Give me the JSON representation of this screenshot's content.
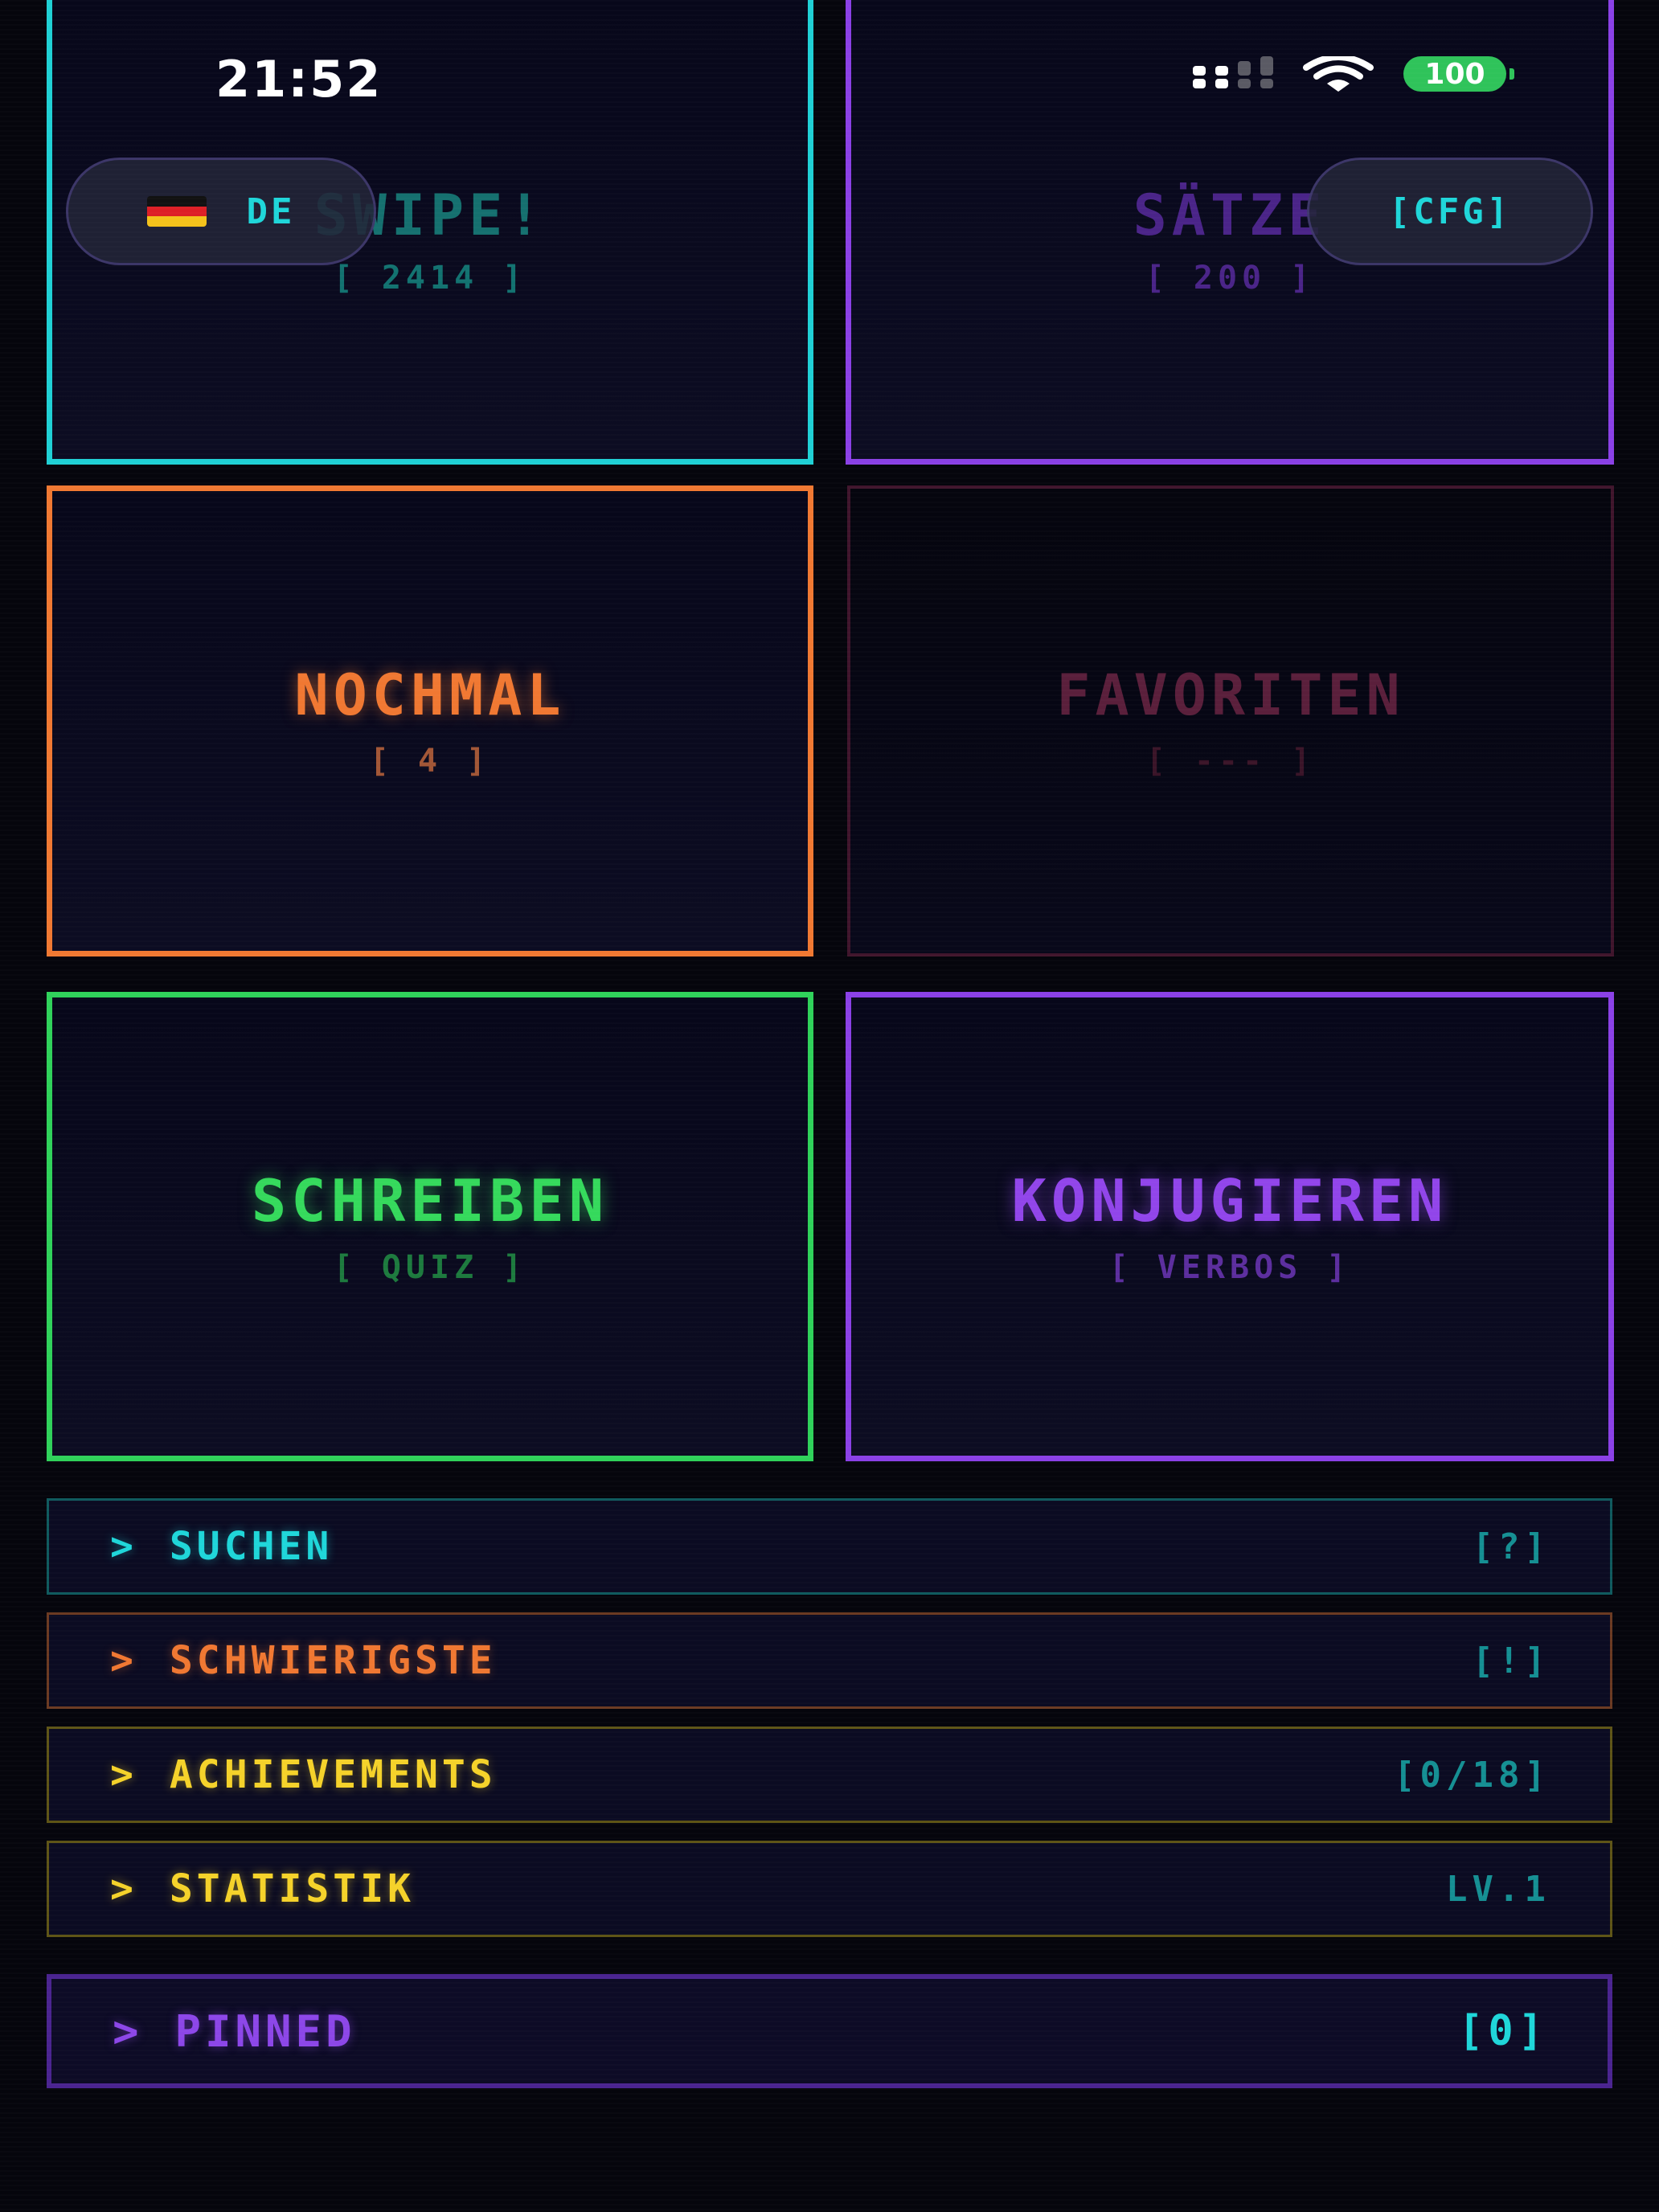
{
  "status_bar": {
    "time": "21:52",
    "battery": "100",
    "icons": [
      "signal-icon",
      "wifi-icon",
      "battery-icon"
    ]
  },
  "header": {
    "language_flag": "flag-de-icon",
    "language_label": "DE",
    "config_label": "[CFG]"
  },
  "tiles": {
    "swipe": {
      "title": "SWIPE!",
      "subtitle": "[ 2414 ]"
    },
    "saetze": {
      "title": "SÄTZE",
      "subtitle": "[ 200 ]"
    },
    "nochmal": {
      "title": "NOCHMAL",
      "subtitle": "[ 4 ]"
    },
    "favoriten": {
      "title": "FAVORITEN",
      "subtitle": "[ --- ]"
    },
    "schreiben": {
      "title": "SCHREIBEN",
      "subtitle": "[ QUIZ ]"
    },
    "konjugieren": {
      "title": "KONJUGIEREN",
      "subtitle": "[ VERBOS ]"
    }
  },
  "menu": {
    "prompt": ">",
    "items": [
      {
        "label": "SUCHEN",
        "badge": "[?]"
      },
      {
        "label": "SCHWIERIGSTE",
        "badge": "[!]"
      },
      {
        "label": "ACHIEVEMENTS",
        "badge": "[0/18]"
      },
      {
        "label": "STATISTIK",
        "badge": "LV.1"
      }
    ],
    "pinned": {
      "label": "PINNED",
      "badge": "[0]"
    }
  },
  "colors": {
    "cyan": "#1fd0d5",
    "purple": "#8a40e6",
    "orange": "#f07832",
    "magenta_dim": "#5a1f3b",
    "green": "#2fd15a",
    "yellow": "#f5d22a",
    "background": "#05050c"
  }
}
